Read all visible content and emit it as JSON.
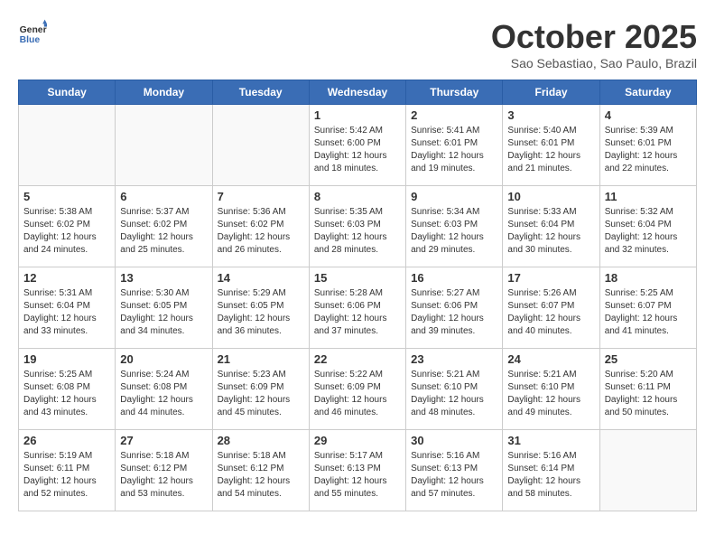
{
  "header": {
    "logo_line1": "General",
    "logo_line2": "Blue",
    "month": "October 2025",
    "location": "Sao Sebastiao, Sao Paulo, Brazil"
  },
  "weekdays": [
    "Sunday",
    "Monday",
    "Tuesday",
    "Wednesday",
    "Thursday",
    "Friday",
    "Saturday"
  ],
  "weeks": [
    [
      {
        "day": "",
        "info": ""
      },
      {
        "day": "",
        "info": ""
      },
      {
        "day": "",
        "info": ""
      },
      {
        "day": "1",
        "info": "Sunrise: 5:42 AM\nSunset: 6:00 PM\nDaylight: 12 hours\nand 18 minutes."
      },
      {
        "day": "2",
        "info": "Sunrise: 5:41 AM\nSunset: 6:01 PM\nDaylight: 12 hours\nand 19 minutes."
      },
      {
        "day": "3",
        "info": "Sunrise: 5:40 AM\nSunset: 6:01 PM\nDaylight: 12 hours\nand 21 minutes."
      },
      {
        "day": "4",
        "info": "Sunrise: 5:39 AM\nSunset: 6:01 PM\nDaylight: 12 hours\nand 22 minutes."
      }
    ],
    [
      {
        "day": "5",
        "info": "Sunrise: 5:38 AM\nSunset: 6:02 PM\nDaylight: 12 hours\nand 24 minutes."
      },
      {
        "day": "6",
        "info": "Sunrise: 5:37 AM\nSunset: 6:02 PM\nDaylight: 12 hours\nand 25 minutes."
      },
      {
        "day": "7",
        "info": "Sunrise: 5:36 AM\nSunset: 6:02 PM\nDaylight: 12 hours\nand 26 minutes."
      },
      {
        "day": "8",
        "info": "Sunrise: 5:35 AM\nSunset: 6:03 PM\nDaylight: 12 hours\nand 28 minutes."
      },
      {
        "day": "9",
        "info": "Sunrise: 5:34 AM\nSunset: 6:03 PM\nDaylight: 12 hours\nand 29 minutes."
      },
      {
        "day": "10",
        "info": "Sunrise: 5:33 AM\nSunset: 6:04 PM\nDaylight: 12 hours\nand 30 minutes."
      },
      {
        "day": "11",
        "info": "Sunrise: 5:32 AM\nSunset: 6:04 PM\nDaylight: 12 hours\nand 32 minutes."
      }
    ],
    [
      {
        "day": "12",
        "info": "Sunrise: 5:31 AM\nSunset: 6:04 PM\nDaylight: 12 hours\nand 33 minutes."
      },
      {
        "day": "13",
        "info": "Sunrise: 5:30 AM\nSunset: 6:05 PM\nDaylight: 12 hours\nand 34 minutes."
      },
      {
        "day": "14",
        "info": "Sunrise: 5:29 AM\nSunset: 6:05 PM\nDaylight: 12 hours\nand 36 minutes."
      },
      {
        "day": "15",
        "info": "Sunrise: 5:28 AM\nSunset: 6:06 PM\nDaylight: 12 hours\nand 37 minutes."
      },
      {
        "day": "16",
        "info": "Sunrise: 5:27 AM\nSunset: 6:06 PM\nDaylight: 12 hours\nand 39 minutes."
      },
      {
        "day": "17",
        "info": "Sunrise: 5:26 AM\nSunset: 6:07 PM\nDaylight: 12 hours\nand 40 minutes."
      },
      {
        "day": "18",
        "info": "Sunrise: 5:25 AM\nSunset: 6:07 PM\nDaylight: 12 hours\nand 41 minutes."
      }
    ],
    [
      {
        "day": "19",
        "info": "Sunrise: 5:25 AM\nSunset: 6:08 PM\nDaylight: 12 hours\nand 43 minutes."
      },
      {
        "day": "20",
        "info": "Sunrise: 5:24 AM\nSunset: 6:08 PM\nDaylight: 12 hours\nand 44 minutes."
      },
      {
        "day": "21",
        "info": "Sunrise: 5:23 AM\nSunset: 6:09 PM\nDaylight: 12 hours\nand 45 minutes."
      },
      {
        "day": "22",
        "info": "Sunrise: 5:22 AM\nSunset: 6:09 PM\nDaylight: 12 hours\nand 46 minutes."
      },
      {
        "day": "23",
        "info": "Sunrise: 5:21 AM\nSunset: 6:10 PM\nDaylight: 12 hours\nand 48 minutes."
      },
      {
        "day": "24",
        "info": "Sunrise: 5:21 AM\nSunset: 6:10 PM\nDaylight: 12 hours\nand 49 minutes."
      },
      {
        "day": "25",
        "info": "Sunrise: 5:20 AM\nSunset: 6:11 PM\nDaylight: 12 hours\nand 50 minutes."
      }
    ],
    [
      {
        "day": "26",
        "info": "Sunrise: 5:19 AM\nSunset: 6:11 PM\nDaylight: 12 hours\nand 52 minutes."
      },
      {
        "day": "27",
        "info": "Sunrise: 5:18 AM\nSunset: 6:12 PM\nDaylight: 12 hours\nand 53 minutes."
      },
      {
        "day": "28",
        "info": "Sunrise: 5:18 AM\nSunset: 6:12 PM\nDaylight: 12 hours\nand 54 minutes."
      },
      {
        "day": "29",
        "info": "Sunrise: 5:17 AM\nSunset: 6:13 PM\nDaylight: 12 hours\nand 55 minutes."
      },
      {
        "day": "30",
        "info": "Sunrise: 5:16 AM\nSunset: 6:13 PM\nDaylight: 12 hours\nand 57 minutes."
      },
      {
        "day": "31",
        "info": "Sunrise: 5:16 AM\nSunset: 6:14 PM\nDaylight: 12 hours\nand 58 minutes."
      },
      {
        "day": "",
        "info": ""
      }
    ]
  ]
}
